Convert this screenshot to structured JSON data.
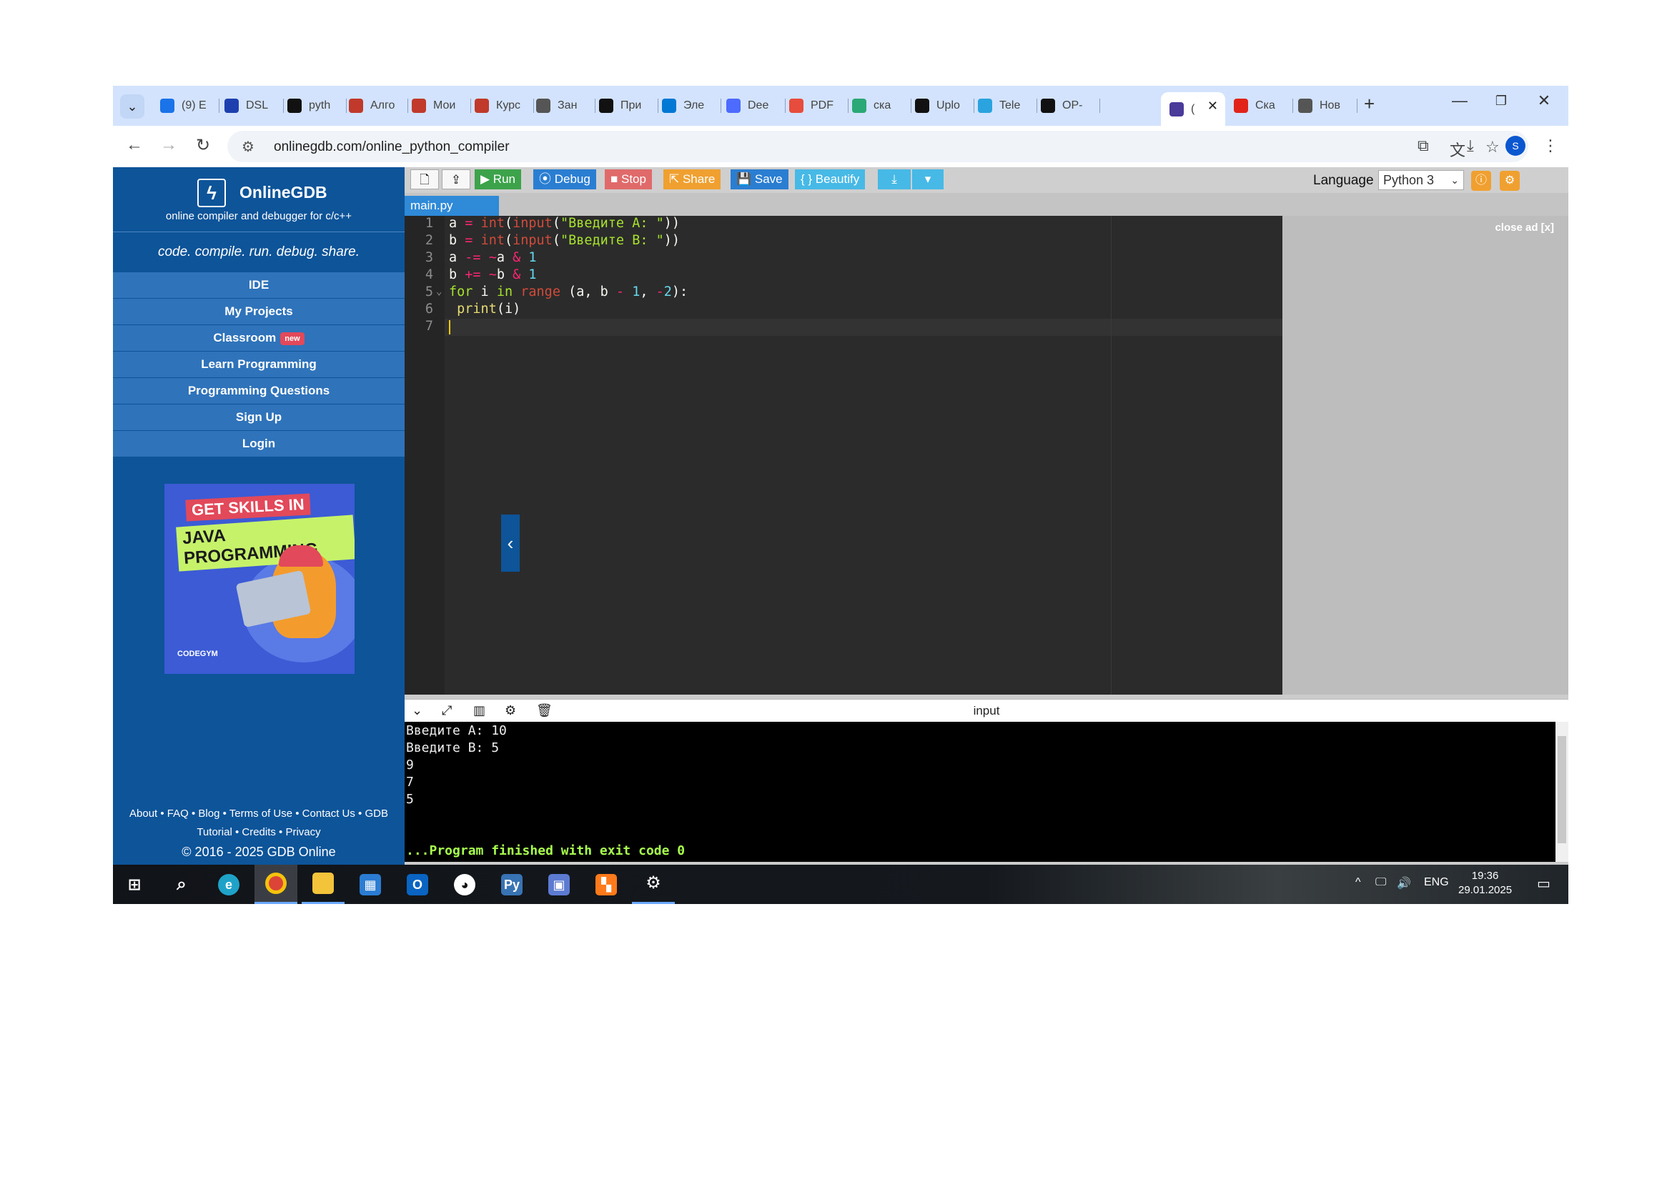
{
  "browser": {
    "tabs": [
      {
        "label": "(9) E",
        "icon": "mail-icon",
        "color": "#1a73e8"
      },
      {
        "label": "DSL",
        "icon": "dsl-icon",
        "color": "#1e40af"
      },
      {
        "label": "pyth",
        "icon": "github-icon",
        "color": "#111111"
      },
      {
        "label": "Алго",
        "icon": "habr-icon",
        "color": "#c0392b"
      },
      {
        "label": "Мои",
        "icon": "habr-icon",
        "color": "#c0392b"
      },
      {
        "label": "Курс",
        "icon": "habr-icon",
        "color": "#c0392b"
      },
      {
        "label": "Зан",
        "icon": "globe-icon",
        "color": "#555555"
      },
      {
        "label": "При",
        "icon": "github-icon",
        "color": "#111111"
      },
      {
        "label": "Эле",
        "icon": "cloud-icon",
        "color": "#0078d4"
      },
      {
        "label": "Dee",
        "icon": "deepseek-icon",
        "color": "#4d6bfe"
      },
      {
        "label": "PDF",
        "icon": "pdf-icon",
        "color": "#e74c3c"
      },
      {
        "label": "ска",
        "icon": "game-icon",
        "color": "#2aa876"
      },
      {
        "label": "Uplo",
        "icon": "github-icon",
        "color": "#111111"
      },
      {
        "label": "Tele",
        "icon": "telegram-icon",
        "color": "#2aa3df"
      },
      {
        "label": "OP-",
        "icon": "github-icon",
        "color": "#111111"
      },
      {
        "label": "(",
        "icon": "onlinegdb-icon",
        "color": "#4a3a9a"
      },
      {
        "label": "Ска",
        "icon": "opera-icon",
        "color": "#e2231a"
      },
      {
        "label": "Нов",
        "icon": "chrome-icon",
        "color": "#555555"
      }
    ],
    "url": "onlinegdb.com/online_python_compiler",
    "profile_initial": "S"
  },
  "sidebar": {
    "brand_name": "OnlineGDB",
    "brand_sub": "online compiler and debugger for c/c++",
    "tagline": "code. compile. run. debug. share.",
    "menu": [
      {
        "label": "IDE"
      },
      {
        "label": "My Projects"
      },
      {
        "label": "Classroom",
        "badge": "new"
      },
      {
        "label": "Learn Programming"
      },
      {
        "label": "Programming Questions"
      },
      {
        "label": "Sign Up"
      },
      {
        "label": "Login"
      }
    ],
    "ad": {
      "line1": "GET SKILLS IN",
      "line2": "JAVA PROGRAMMING",
      "logo": "CODEGYM"
    },
    "footer_links_1": "About • FAQ • Blog • Terms of Use • Contact Us • GDB",
    "footer_links_2": "Tutorial • Credits • Privacy",
    "copyright": "© 2016 - 2025 GDB Online"
  },
  "ide": {
    "buttons": {
      "run": "Run",
      "debug": "Debug",
      "stop": "Stop",
      "share": "Share",
      "save": "Save",
      "beautify": "{ } Beautify"
    },
    "language_label": "Language",
    "language_value": "Python 3",
    "file_tab": "main.py",
    "close_ad": "close ad [x]",
    "code_lines": [
      {
        "n": "1",
        "text": "a = int(input(\"Введите A: \"))"
      },
      {
        "n": "2",
        "text": "b = int(input(\"Введите B: \"))"
      },
      {
        "n": "3",
        "text": "a -= ~a & 1"
      },
      {
        "n": "4",
        "text": "b += ~b & 1"
      },
      {
        "n": "5",
        "text": "for i in range (a, b - 1, -2):"
      },
      {
        "n": "6",
        "text": " print(i)"
      },
      {
        "n": "7",
        "text": ""
      }
    ],
    "io_title": "input",
    "console_lines": [
      "Введите A: 10",
      "Введите B: 5",
      "9",
      "7",
      "5"
    ],
    "console_finish": "...Program finished with exit code 0"
  },
  "taskbar": {
    "apps": [
      "windows-start",
      "search",
      "edge",
      "chrome",
      "file-explorer",
      "store",
      "outlook",
      "github-desktop",
      "python",
      "network-tool",
      "office-tool",
      "settings"
    ],
    "lang": "ENG",
    "time": "19:36",
    "date": "29.01.2025"
  }
}
